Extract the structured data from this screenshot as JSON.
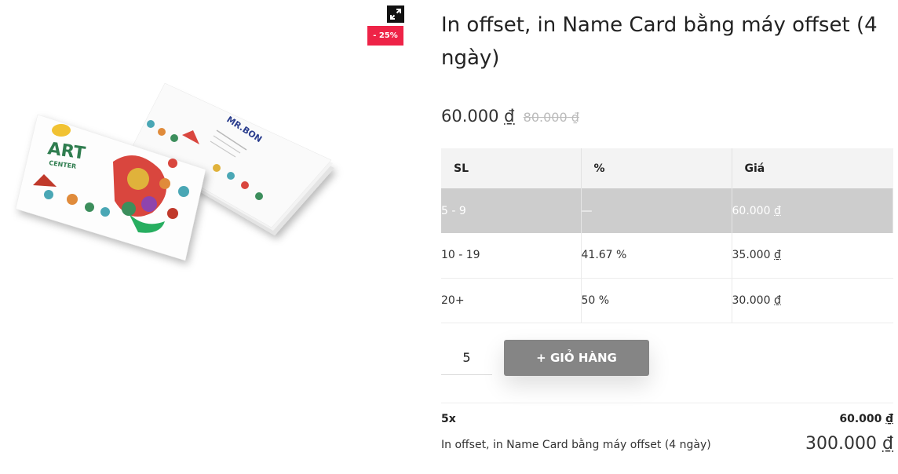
{
  "gallery": {
    "sale_badge": "- 25%",
    "expand_icon": "expand-arrows-icon",
    "card_front_logo": "ART",
    "card_front_logo_sub": "CENTER",
    "card_back_name": "MR.BON"
  },
  "product": {
    "title": "In offset, in Name Card bằng máy offset (4 ngày)",
    "price": "60.000",
    "old_price": "80.000",
    "currency": "₫"
  },
  "tier_table": {
    "headers": [
      "SL",
      "%",
      "Giá"
    ],
    "rows": [
      {
        "qty": "5 - 9",
        "percent": "—",
        "price": "60.000",
        "active": true
      },
      {
        "qty": "10 - 19",
        "percent": "41.67 %",
        "price": "35.000",
        "active": false
      },
      {
        "qty": "20+",
        "percent": "50 %",
        "price": "30.000",
        "active": false
      }
    ]
  },
  "cart": {
    "quantity": "5",
    "button_label": "+ GIỎ HÀNG"
  },
  "totals": {
    "qty_label": "5x",
    "unit_price": "60.000",
    "product_name": "In offset, in Name Card bằng máy offset (4 ngày)",
    "total_price": "300.000"
  },
  "colors": {
    "sale_badge": "#ee2347",
    "cart_button": "#858585",
    "active_row": "#cdcdcd",
    "header_row": "#f3f3f3"
  }
}
